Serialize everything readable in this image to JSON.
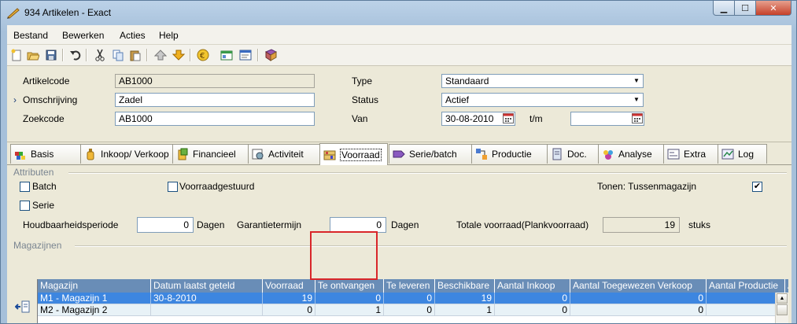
{
  "window": {
    "title": "934 Artikelen - Exact"
  },
  "menu": [
    "Bestand",
    "Bewerken",
    "Acties",
    "Help"
  ],
  "toolbar": [
    "new-icon",
    "open-icon",
    "save-icon",
    "undo-icon",
    "cut-icon",
    "copy-icon",
    "paste-icon",
    "up-icon",
    "down-icon",
    "euro-icon",
    "grid-icon",
    "window-icon",
    "book-icon"
  ],
  "header": {
    "artikelcode_label": "Artikelcode",
    "artikelcode": "AB1000",
    "omschrijving_marker": "›",
    "omschrijving_label": "Omschrijving",
    "omschrijving": "Zadel",
    "zoekcode_label": "Zoekcode",
    "zoekcode": "AB1000",
    "type_label": "Type",
    "type": "Standaard",
    "status_label": "Status",
    "status": "Actief",
    "van_label": "Van",
    "van": "30-08-2010",
    "tm_label": "t/m",
    "tm": ""
  },
  "tabs": [
    {
      "label": "Basis"
    },
    {
      "label": "Inkoop/ Verkoop"
    },
    {
      "label": "Financieel"
    },
    {
      "label": "Activiteit"
    },
    {
      "label": "Voorraad"
    },
    {
      "label": "Serie/batch"
    },
    {
      "label": "Productie"
    },
    {
      "label": "Doc."
    },
    {
      "label": "Analyse"
    },
    {
      "label": "Extra"
    },
    {
      "label": "Log"
    }
  ],
  "attributen": {
    "section": "Attributen",
    "batch": "Batch",
    "serie": "Serie",
    "voorraadgestuurd": "Voorraadgestuurd",
    "tonen_label": "Tonen: Tussenmagazijn",
    "tonen_checked": true,
    "houdbaarheid_label": "Houdbaarheidsperiode",
    "houdbaarheid": "0",
    "dagen1": "Dagen",
    "garantie_label": "Garantietermijn",
    "garantie": "0",
    "dagen2": "Dagen",
    "totale_label": "Totale voorraad(Plankvoorraad)",
    "totale": "19",
    "stuks": "stuks"
  },
  "magazijnen": {
    "section": "Magazijnen",
    "columns": [
      "Magazijn",
      "Datum laatst geteld",
      "Voorraad",
      "Te ontvangen",
      "Te leveren",
      "Beschikbare",
      "Aantal Inkoop",
      "Aantal Toegewezen Verkoop",
      "Aantal Productie",
      "A"
    ],
    "rows": [
      [
        "M1   - Magazijn 1",
        "30-8-2010",
        "19",
        "0",
        "0",
        "19",
        "0",
        "0",
        "0"
      ],
      [
        "M2   - Magazijn 2",
        "",
        "0",
        "1",
        "0",
        "1",
        "0",
        "0",
        "0"
      ]
    ]
  }
}
